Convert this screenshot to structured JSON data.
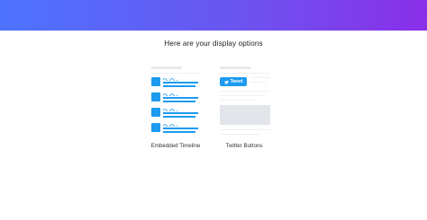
{
  "page": {
    "heading": "Here are your display options"
  },
  "options": [
    {
      "label": "Embedded Timeline",
      "icon": "timeline-illustration"
    },
    {
      "label": "Twitter Buttons",
      "icon": "buttons-illustration",
      "button_text": "Tweet"
    }
  ],
  "colors": {
    "banner_start": "#4d73ff",
    "banner_end": "#8a2fe8",
    "twitter_blue": "#1d9bf0"
  }
}
